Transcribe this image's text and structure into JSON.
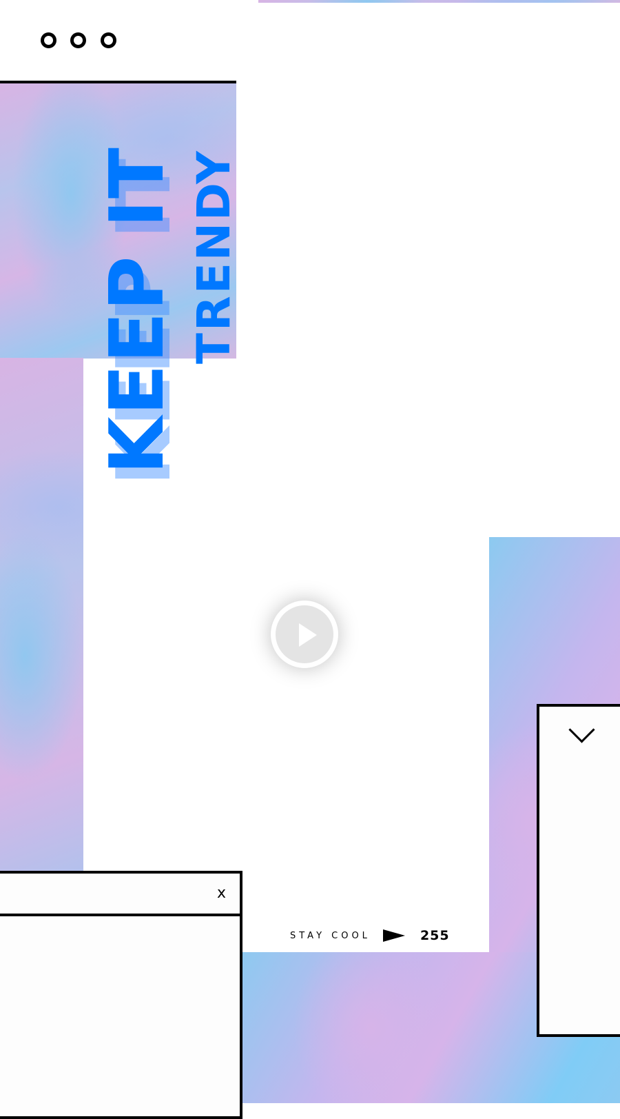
{
  "hero": {
    "line1": "KEEP IT",
    "line2": "TRENDY"
  },
  "footer": {
    "tagline": "STAY COOL",
    "count": "255"
  },
  "window": {
    "close_label": "x"
  },
  "icons": {
    "menu": "three-dots-icon",
    "play": "play-icon",
    "arrow": "triangle-right-icon",
    "chevron": "chevron-down-icon"
  },
  "colors": {
    "accent": "#0078ff",
    "frame": "#000000"
  }
}
